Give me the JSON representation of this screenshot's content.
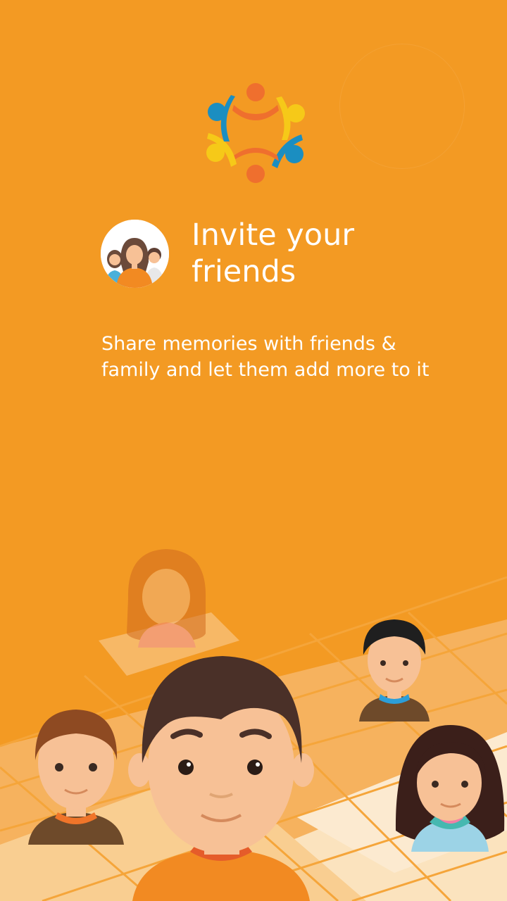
{
  "onboarding": {
    "headline": "Invite your\nfriends",
    "description": "Share memories with friends &\nfamily and let them add more to it"
  },
  "icons": {
    "logo": "community-circle-icon",
    "hero": "group-of-friends-icon"
  },
  "colors": {
    "background": "#F39A23",
    "text": "#FFFFFF",
    "logo_orange": "#EF6F2E",
    "logo_blue": "#1B8EC1",
    "logo_yellow": "#F6C918"
  }
}
